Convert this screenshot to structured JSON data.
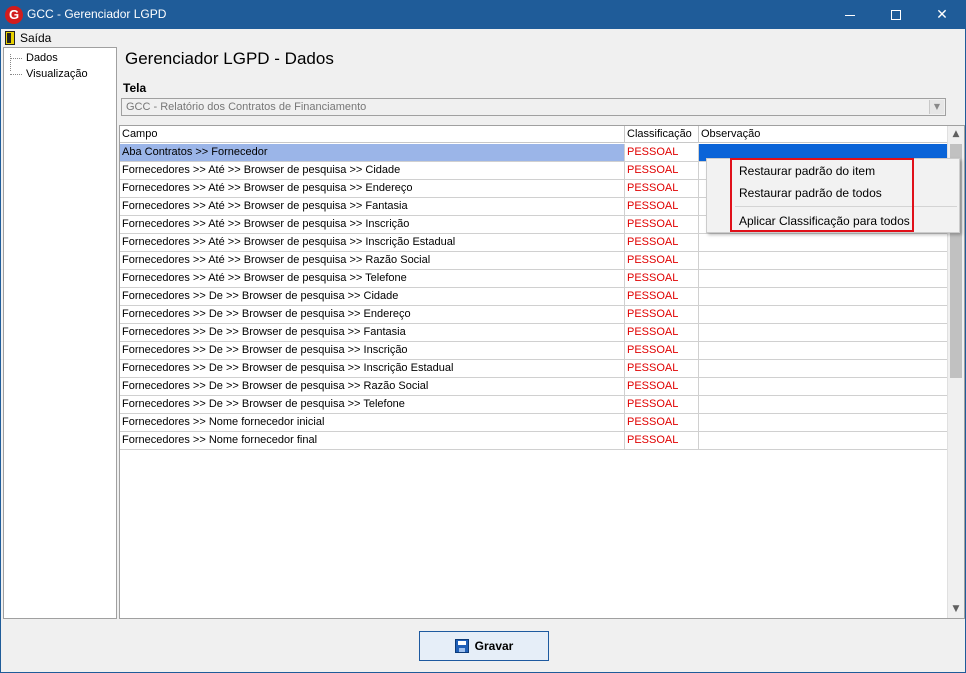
{
  "window": {
    "title": "GCC - Gerenciador LGPD"
  },
  "menu": {
    "exit_label": "Saída"
  },
  "tree": {
    "items": [
      "Dados",
      "Visualização"
    ]
  },
  "page": {
    "title": "Gerenciador LGPD - Dados",
    "tela_label": "Tela",
    "tela_value": "GCC - Relatório dos Contratos de Financiamento"
  },
  "grid": {
    "columns": [
      "Campo",
      "Classificação",
      "Observação"
    ],
    "rows": [
      {
        "campo": "Aba Contratos >> Fornecedor",
        "classificacao": "PESSOAL",
        "observacao": ""
      },
      {
        "campo": "Fornecedores >> Até >> Browser de pesquisa >> Cidade",
        "classificacao": "PESSOAL",
        "observacao": ""
      },
      {
        "campo": "Fornecedores >> Até >> Browser de pesquisa >> Endereço",
        "classificacao": "PESSOAL",
        "observacao": ""
      },
      {
        "campo": "Fornecedores >> Até >> Browser de pesquisa >> Fantasia",
        "classificacao": "PESSOAL",
        "observacao": ""
      },
      {
        "campo": "Fornecedores >> Até >> Browser de pesquisa >> Inscrição",
        "classificacao": "PESSOAL",
        "observacao": ""
      },
      {
        "campo": "Fornecedores >> Até >> Browser de pesquisa >> Inscrição Estadual",
        "classificacao": "PESSOAL",
        "observacao": ""
      },
      {
        "campo": "Fornecedores >> Até >> Browser de pesquisa >> Razão Social",
        "classificacao": "PESSOAL",
        "observacao": ""
      },
      {
        "campo": "Fornecedores >> Até >> Browser de pesquisa >> Telefone",
        "classificacao": "PESSOAL",
        "observacao": ""
      },
      {
        "campo": "Fornecedores >> De >> Browser de pesquisa >> Cidade",
        "classificacao": "PESSOAL",
        "observacao": ""
      },
      {
        "campo": "Fornecedores >> De >> Browser de pesquisa >> Endereço",
        "classificacao": "PESSOAL",
        "observacao": ""
      },
      {
        "campo": "Fornecedores >> De >> Browser de pesquisa >> Fantasia",
        "classificacao": "PESSOAL",
        "observacao": ""
      },
      {
        "campo": "Fornecedores >> De >> Browser de pesquisa >> Inscrição",
        "classificacao": "PESSOAL",
        "observacao": ""
      },
      {
        "campo": "Fornecedores >> De >> Browser de pesquisa >> Inscrição Estadual",
        "classificacao": "PESSOAL",
        "observacao": ""
      },
      {
        "campo": "Fornecedores >> De >> Browser de pesquisa >> Razão Social",
        "classificacao": "PESSOAL",
        "observacao": ""
      },
      {
        "campo": "Fornecedores >> De >> Browser de pesquisa >> Telefone",
        "classificacao": "PESSOAL",
        "observacao": ""
      },
      {
        "campo": "Fornecedores >> Nome fornecedor inicial",
        "classificacao": "PESSOAL",
        "observacao": ""
      },
      {
        "campo": "Fornecedores >> Nome fornecedor final",
        "classificacao": "PESSOAL",
        "observacao": ""
      }
    ]
  },
  "context_menu": {
    "items": [
      "Restaurar padrão do item",
      "Restaurar padrão de todos",
      "Aplicar Classificação para todos"
    ]
  },
  "footer": {
    "save_label": "Gravar"
  },
  "colors": {
    "accent": "#1f5c99",
    "classification_text": "#e00000",
    "selection": "#0a64d8",
    "highlight_box": "#e0101a"
  }
}
